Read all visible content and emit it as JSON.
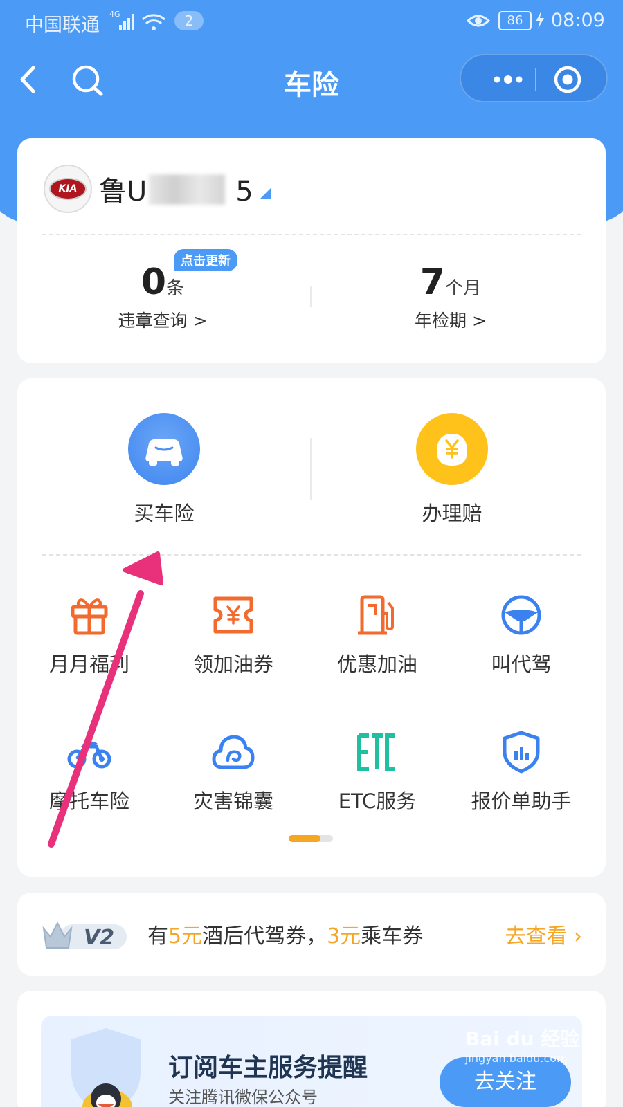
{
  "status_bar": {
    "carrier": "中国联通",
    "network": "4G",
    "notification_count": "2",
    "battery": "86",
    "time": "08:09"
  },
  "nav": {
    "title": "车险"
  },
  "vehicle": {
    "brand_logo_text": "KIA",
    "plate_prefix": "鲁U",
    "plate_suffix": "5",
    "update_badge": "点击更新",
    "violations": {
      "value": "0",
      "unit": "条",
      "label": "违章查询 >"
    },
    "inspection": {
      "value": "7",
      "unit": "个月",
      "label": "年检期 >"
    }
  },
  "services": {
    "primary": [
      {
        "label": "买车险",
        "icon": "car-icon",
        "color": "#4b8ff3"
      },
      {
        "label": "办理赔",
        "icon": "yen-coin-icon",
        "color": "#ffc21a"
      }
    ],
    "grid": [
      {
        "label": "月月福利",
        "icon": "gift-icon",
        "color": "#f26a2e"
      },
      {
        "label": "领加油券",
        "icon": "fuel-coupon-icon",
        "color": "#f26a2e"
      },
      {
        "label": "优惠加油",
        "icon": "fuel-pump-icon",
        "color": "#f26a2e"
      },
      {
        "label": "叫代驾",
        "icon": "steering-wheel-icon",
        "color": "#3b82f0"
      },
      {
        "label": "摩托车险",
        "icon": "motorcycle-icon",
        "color": "#3b82f0"
      },
      {
        "label": "灾害锦囊",
        "icon": "cloud-icon",
        "color": "#3b82f0"
      },
      {
        "label": "ETC服务",
        "icon": "etc-icon",
        "color": "#1fbf9f"
      },
      {
        "label": "报价单助手",
        "icon": "shield-chart-icon",
        "color": "#3b82f0"
      }
    ],
    "pager_active_fraction": 0.72
  },
  "member": {
    "level": "V2",
    "text_pre": "有",
    "amount1": "5元",
    "text_mid": "酒后代驾券，",
    "amount2": "3元",
    "text_post": "乘车券",
    "link": "去查看 ›"
  },
  "subscribe": {
    "title": "订阅车主服务提醒",
    "desc": "关注腾讯微保公众号",
    "button": "去关注"
  },
  "watermark": {
    "text": "Bai du 经验",
    "url": "jingyan.baidu.com"
  },
  "colors": {
    "primary": "#4b9af5",
    "accent": "#f5a623",
    "annotation": "#e8317a"
  }
}
